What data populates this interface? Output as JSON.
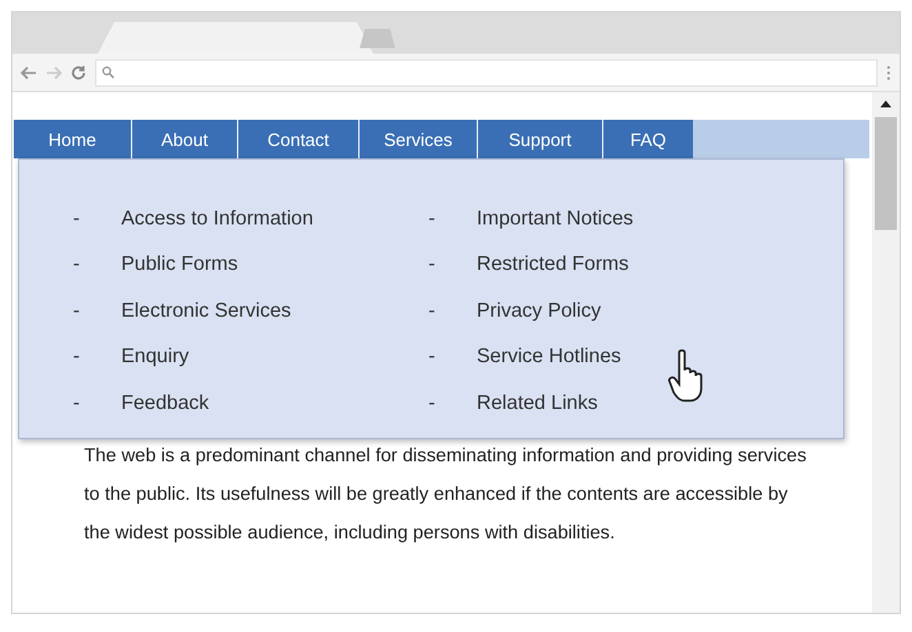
{
  "nav": [
    {
      "label": "Home"
    },
    {
      "label": "About"
    },
    {
      "label": "Contact"
    },
    {
      "label": "Services"
    },
    {
      "label": "Support"
    },
    {
      "label": "FAQ"
    }
  ],
  "dropdown": {
    "columns": [
      [
        {
          "marker": "-",
          "label": "Access to Information"
        },
        {
          "marker": "-",
          "label": "Public Forms"
        },
        {
          "marker": "-",
          "label": "Electronic Services"
        },
        {
          "marker": "-",
          "label": "Enquiry"
        },
        {
          "marker": "-",
          "label": "Feedback"
        }
      ],
      [
        {
          "marker": "-",
          "label": "Important Notices"
        },
        {
          "marker": "-",
          "label": "Restricted Forms"
        },
        {
          "marker": "-",
          "label": "Privacy Policy"
        },
        {
          "marker": "-",
          "label": "Service Hotlines"
        },
        {
          "marker": "-",
          "label": "Related Links"
        }
      ]
    ]
  },
  "paragraph": "The web is a predominant channel for disseminating information and providing services to the public. Its usefulness will be greatly enhanced if the contents are accessible by the widest possible audience, including persons with disabilities."
}
